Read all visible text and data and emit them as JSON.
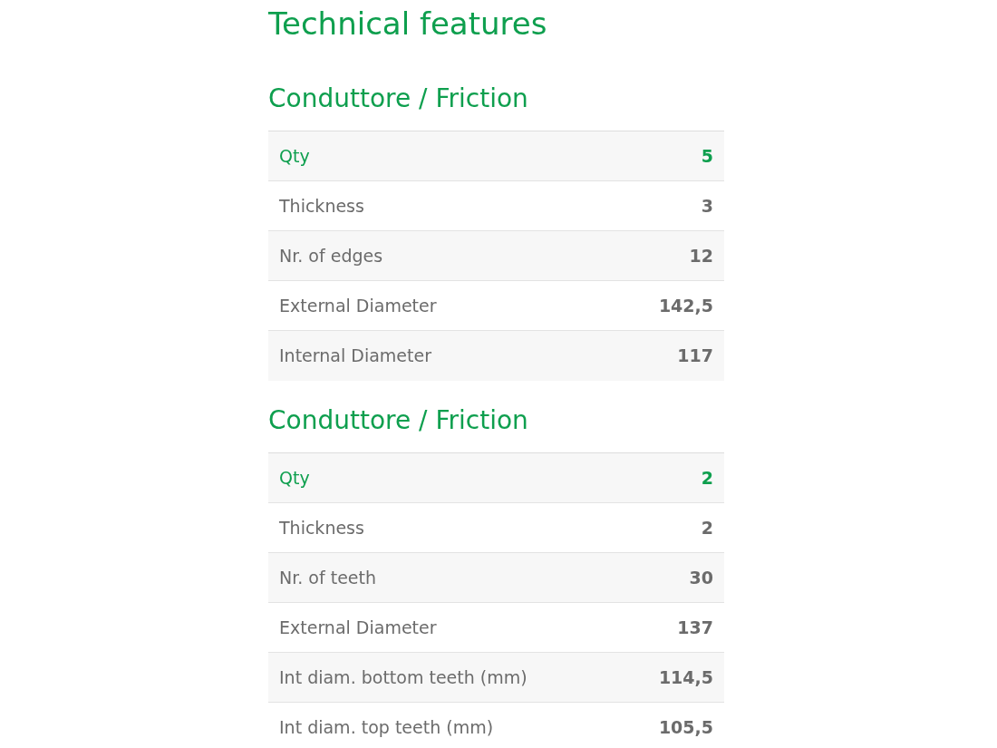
{
  "title": "Technical features",
  "sections": [
    {
      "heading": "Conduttore / Friction",
      "rows": [
        {
          "label": "Qty",
          "value": "5",
          "highlighted": true
        },
        {
          "label": "Thickness",
          "value": "3",
          "highlighted": false
        },
        {
          "label": "Nr. of edges",
          "value": "12",
          "highlighted": false
        },
        {
          "label": "External Diameter",
          "value": "142,5",
          "highlighted": false
        },
        {
          "label": "Internal Diameter",
          "value": "117",
          "highlighted": false
        }
      ]
    },
    {
      "heading": "Conduttore / Friction",
      "rows": [
        {
          "label": "Qty",
          "value": "2",
          "highlighted": true
        },
        {
          "label": "Thickness",
          "value": "2",
          "highlighted": false
        },
        {
          "label": "Nr. of teeth",
          "value": "30",
          "highlighted": false
        },
        {
          "label": "External Diameter",
          "value": "137",
          "highlighted": false
        },
        {
          "label": "Int diam. bottom teeth (mm)",
          "value": "114,5",
          "highlighted": false
        },
        {
          "label": "Int diam. top teeth (mm)",
          "value": "105,5",
          "highlighted": false
        }
      ]
    }
  ]
}
